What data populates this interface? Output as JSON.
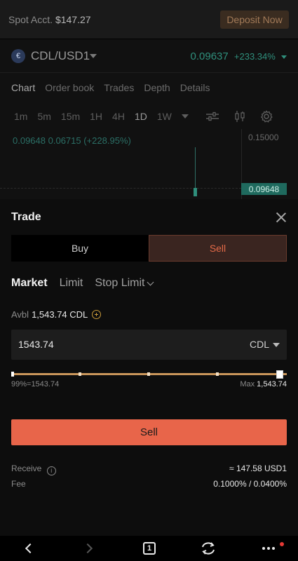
{
  "account": {
    "label": "Spot Acct.",
    "balance": "$147.27",
    "deposit_label": "Deposit Now"
  },
  "market": {
    "coin_icon": "€",
    "pair": "CDL/USD1",
    "price": "0.09637",
    "change": "+233.34%"
  },
  "chart_tabs": [
    "Chart",
    "Order book",
    "Trades",
    "Depth",
    "Details"
  ],
  "intervals": [
    "1m",
    "5m",
    "15m",
    "1H",
    "4H",
    "1D",
    "1W"
  ],
  "chart": {
    "price_a": "0.09648",
    "price_b": "0.06715",
    "change": "(+228.95%)",
    "axis_top": "0.15000",
    "current": "0.09648"
  },
  "trade": {
    "title": "Trade",
    "buy_label": "Buy",
    "sell_label": "Sell",
    "order_types": [
      "Market",
      "Limit",
      "Stop Limit"
    ],
    "avbl_label": "Avbl",
    "avbl_value": "1,543.74 CDL",
    "amount_value": "1543.74",
    "amount_unit": "CDL",
    "slider_pct_text": "99%=1543.74",
    "slider_fraction": 0.99,
    "max_label": "Max",
    "max_value": "1,543.74",
    "submit_label": "Sell",
    "receive_label": "Receive",
    "receive_value": "≈ 147.58 USD1",
    "fee_label": "Fee",
    "fee_value": "0.1000% / 0.0400%"
  },
  "browser": {
    "tab_count": "1"
  },
  "colors": {
    "accent_sell": "#e8654a",
    "accent_up": "#2f8f7c",
    "slider": "#c8955a"
  }
}
